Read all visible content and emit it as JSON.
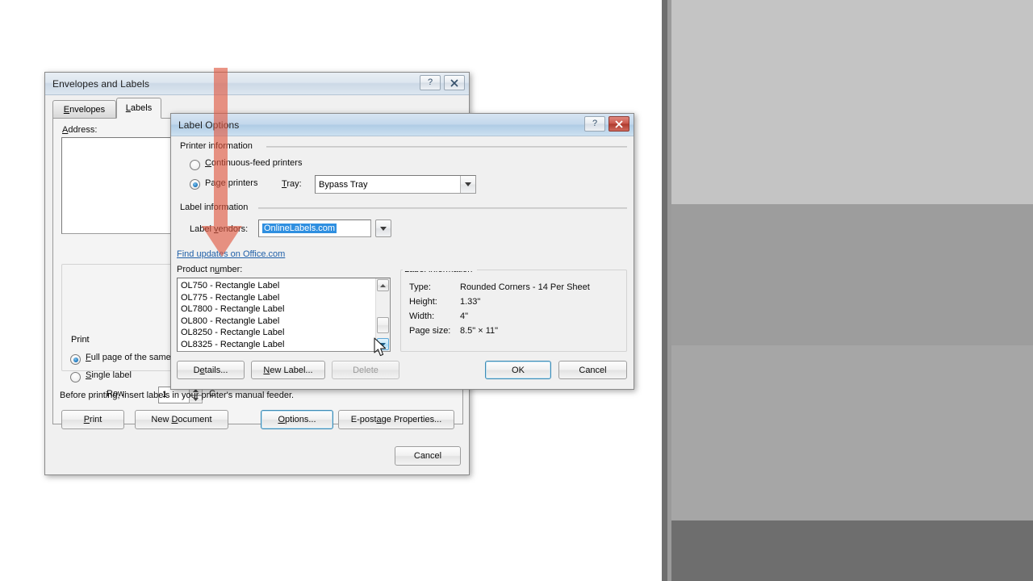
{
  "envelopes_dialog": {
    "title": "Envelopes and Labels",
    "titlebar_buttons": {
      "help": "?",
      "close": "✕"
    },
    "tabs": [
      {
        "label": "Envelopes",
        "active": false
      },
      {
        "label": "Labels",
        "active": true
      }
    ],
    "address_label": "Address:",
    "address_value": "",
    "print_group": {
      "legend": "Print",
      "options": [
        {
          "label": "Full page of the same label",
          "selected": true
        },
        {
          "label": "Single label",
          "selected": false
        }
      ],
      "row_label": "Row:",
      "row_value": "1",
      "column_label": "C"
    },
    "hint": "Before printing, insert labels in your printer's manual feeder.",
    "buttons": [
      {
        "label": "Print",
        "default": false
      },
      {
        "label": "New Document",
        "default": false
      },
      {
        "label": "Options...",
        "default": true
      },
      {
        "label": "E-postage Properties...",
        "default": false
      }
    ],
    "cancel_label": "Cancel"
  },
  "label_options_dialog": {
    "title": "Label Options",
    "titlebar_buttons": {
      "help": "?",
      "close": "✕"
    },
    "printer_information": {
      "legend": "Printer information",
      "options": [
        {
          "label": "Continuous-feed printers",
          "selected": false
        },
        {
          "label": "Page printers",
          "selected": true
        }
      ],
      "tray_label": "Tray:",
      "tray_value": "Bypass Tray"
    },
    "label_information_group": {
      "legend": "Label information",
      "vendors_label": "Label vendors:",
      "vendors_value": "OnlineLabels.com",
      "update_link": "Find updates on Office.com"
    },
    "product_number": {
      "legend": "Product number:",
      "items": [
        "OL750 - Rectangle Label",
        "OL775 - Rectangle Label",
        "OL7800 - Rectangle Label",
        "OL800 - Rectangle Label",
        "OL8250 - Rectangle Label",
        "OL8325 - Rectangle Label"
      ]
    },
    "label_info_panel": {
      "legend": "Label information",
      "rows": [
        {
          "key": "Type:",
          "value": "Rounded Corners - 14 Per Sheet"
        },
        {
          "key": "Height:",
          "value": "1.33\""
        },
        {
          "key": "Width:",
          "value": "4\""
        },
        {
          "key": "Page size:",
          "value": "8.5\" × 11\""
        }
      ]
    },
    "buttons": [
      {
        "label": "Details...",
        "disabled": false,
        "default": false
      },
      {
        "label": "New Label...",
        "disabled": false,
        "default": false
      },
      {
        "label": "Delete",
        "disabled": true,
        "default": false
      },
      {
        "label": "OK",
        "disabled": false,
        "default": true
      },
      {
        "label": "Cancel",
        "disabled": false,
        "default": false
      }
    ]
  },
  "annotation": {
    "arrow_color": "#e8705c",
    "arrow_description": "downward-pointing-arrow"
  },
  "colors": {
    "accent_selection": "#2f8fe0",
    "link": "#1f5fa8",
    "dialog_face": "#f0f0f0",
    "close_red": "#b3402f",
    "band_light": "#c0c0c0",
    "band_mid": "#9d9d9d",
    "band_dark": "#6e6e6e"
  }
}
